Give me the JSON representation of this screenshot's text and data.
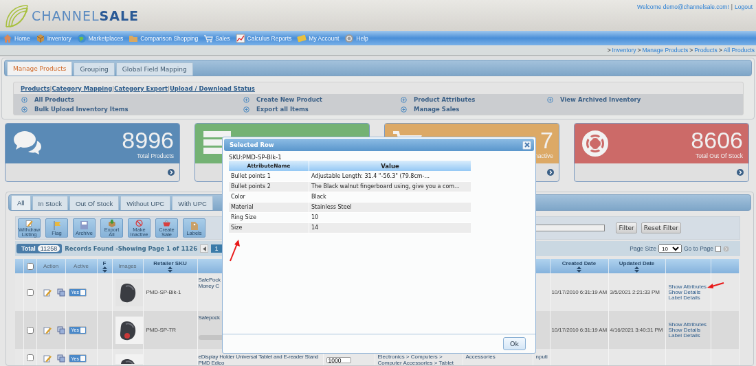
{
  "header": {
    "logo": "CHANNEL**SALE**",
    "welcome": "Welcome demo@channelsale.com!",
    "separator": "|",
    "logout": "Logout"
  },
  "nav": [
    {
      "label": "Home"
    },
    {
      "label": "Inventory"
    },
    {
      "label": "Marketplaces"
    },
    {
      "label": "Comparison Shopping"
    },
    {
      "label": "Sales"
    },
    {
      "label": "Calculus Reports"
    },
    {
      "label": "My Account"
    },
    {
      "label": "Help"
    }
  ],
  "breadcrumb": [
    {
      "sep": ">",
      "label": "Inventory"
    },
    {
      "sep": ">",
      "label": "Manage Products"
    },
    {
      "sep": ">",
      "label": "Products"
    },
    {
      "sep": ">",
      "label": "All Products"
    }
  ],
  "manage_tabs": [
    {
      "label": "Manage Products",
      "selected": true
    },
    {
      "label": "Grouping",
      "selected": false
    },
    {
      "label": "Global Field Mapping",
      "selected": false
    }
  ],
  "sub_links": [
    {
      "label": "Products"
    },
    {
      "sep": "|",
      "label": "Category Mapping"
    },
    {
      "sep": "|",
      "label": "Category Export"
    },
    {
      "sep": "|",
      "label": "Upload / Download Status"
    }
  ],
  "actions": [
    {
      "label": "All Products"
    },
    {
      "label": "Create New Product"
    },
    {
      "label": "Product Attributes"
    },
    {
      "label": "View Archived Inventory"
    },
    {
      "label": "Bulk Upload Inventory Items"
    },
    {
      "label": "Export all Items"
    },
    {
      "label": "Manage Sales"
    }
  ],
  "stats": [
    {
      "kind": "chat",
      "color": "#5a8ab6",
      "number": "8996",
      "label": "Total Products"
    },
    {
      "kind": "server",
      "color": "#74b274"
    },
    {
      "kind": "cart",
      "color": "#dca966",
      "number": "7",
      "label": "nactive"
    },
    {
      "kind": "lifebuoy",
      "color": "#cc6a68",
      "number": "8606",
      "label": "Total Out Of Stock"
    }
  ],
  "stock_tabs": [
    {
      "label": "All",
      "selected": true
    },
    {
      "label": "In Stock",
      "selected": false
    },
    {
      "label": "Out Of Stock",
      "selected": false
    },
    {
      "label": "Without UPC",
      "selected": false
    },
    {
      "label": "With UPC",
      "selected": false
    }
  ],
  "toolbar": [
    {
      "label": "Withdraw Listing"
    },
    {
      "label": "Flag"
    },
    {
      "label": "Archive"
    },
    {
      "label": "Export All"
    },
    {
      "label": "Make Inactive"
    },
    {
      "label": "Create Sale"
    },
    {
      "label": "Labels"
    }
  ],
  "filter": {
    "buttons": [
      "Filter",
      "Reset Filter"
    ]
  },
  "pager": {
    "total_label": "Total",
    "total": "11258",
    "summary": "Records Found -Showing Page 1 of 1126",
    "page": "1",
    "page_size_label": "Page Size",
    "page_size": "10",
    "goto_label": "Go to Page"
  },
  "table": {
    "header_checked": false,
    "columns": [
      {
        "kind": "blank"
      },
      {
        "kind": "check"
      },
      {
        "label": "Action",
        "sortable": false
      },
      {
        "label": "Active",
        "sortable": false
      },
      {
        "label": "F",
        "sortable": true
      },
      {
        "label": "Images",
        "sortable": false
      },
      {
        "label": "Retailer SKU",
        "sortable": true
      },
      {
        "kind": "blank"
      },
      {
        "kind": "blank"
      },
      {
        "kind": "blank"
      },
      {
        "kind": "blank"
      },
      {
        "kind": "blank"
      },
      {
        "label": "Created Date",
        "sortable": true
      },
      {
        "label": "Updated Date",
        "sortable": true
      },
      {
        "kind": "blank"
      },
      {
        "kind": "blank"
      }
    ],
    "rows": [
      {
        "checked": false,
        "active": true,
        "active_label": "Yes",
        "sku": "PMD-SP-Blk-1",
        "title": "SafePock\nMoney C",
        "created": "10/17/2010 6:31:19 AM",
        "updated": "3/5/2021 2:21:33 PM",
        "links": [
          "Show Attributes",
          "Show Details",
          "Label Details"
        ]
      },
      {
        "checked": false,
        "active": true,
        "active_label": "Yes",
        "sku": "PMD-SP-TR",
        "title": "Safepock",
        "bar": true,
        "created": "10/17/2010 6:31:19 AM",
        "updated": "4/16/2021 3:40:31 PM",
        "links": [
          "Show Attributes",
          "Show Details",
          "Label Details"
        ]
      },
      {
        "checked": false,
        "active": true,
        "active_label": "Yes",
        "title": "eDisplay Holder Universal Tablet and E-reader Stand PMD Edico",
        "quantity": "1000",
        "category": "Electronics > Computers > Computer Accessories > Tablet",
        "column_11": "Accessories",
        "column_12": "nputi"
      }
    ]
  },
  "dialog": {
    "title": "Selected Row",
    "sku": "SKU:PMD-SP-Blk-1",
    "columns": [
      "AttributeName",
      "Value"
    ],
    "rows": [
      [
        "Bullet points 1",
        "Adjustable Length: 31.4 \"-56.3\" (79.8cm-..."
      ],
      [
        "Bullet points 2",
        "The Black walnut fingerboard using, give you a com..."
      ],
      [
        "Color",
        "Black"
      ],
      [
        "Material",
        "Stainless Steel"
      ],
      [
        "Ring Size",
        "10"
      ],
      [
        "Size",
        "14"
      ]
    ],
    "button": "Ok"
  }
}
